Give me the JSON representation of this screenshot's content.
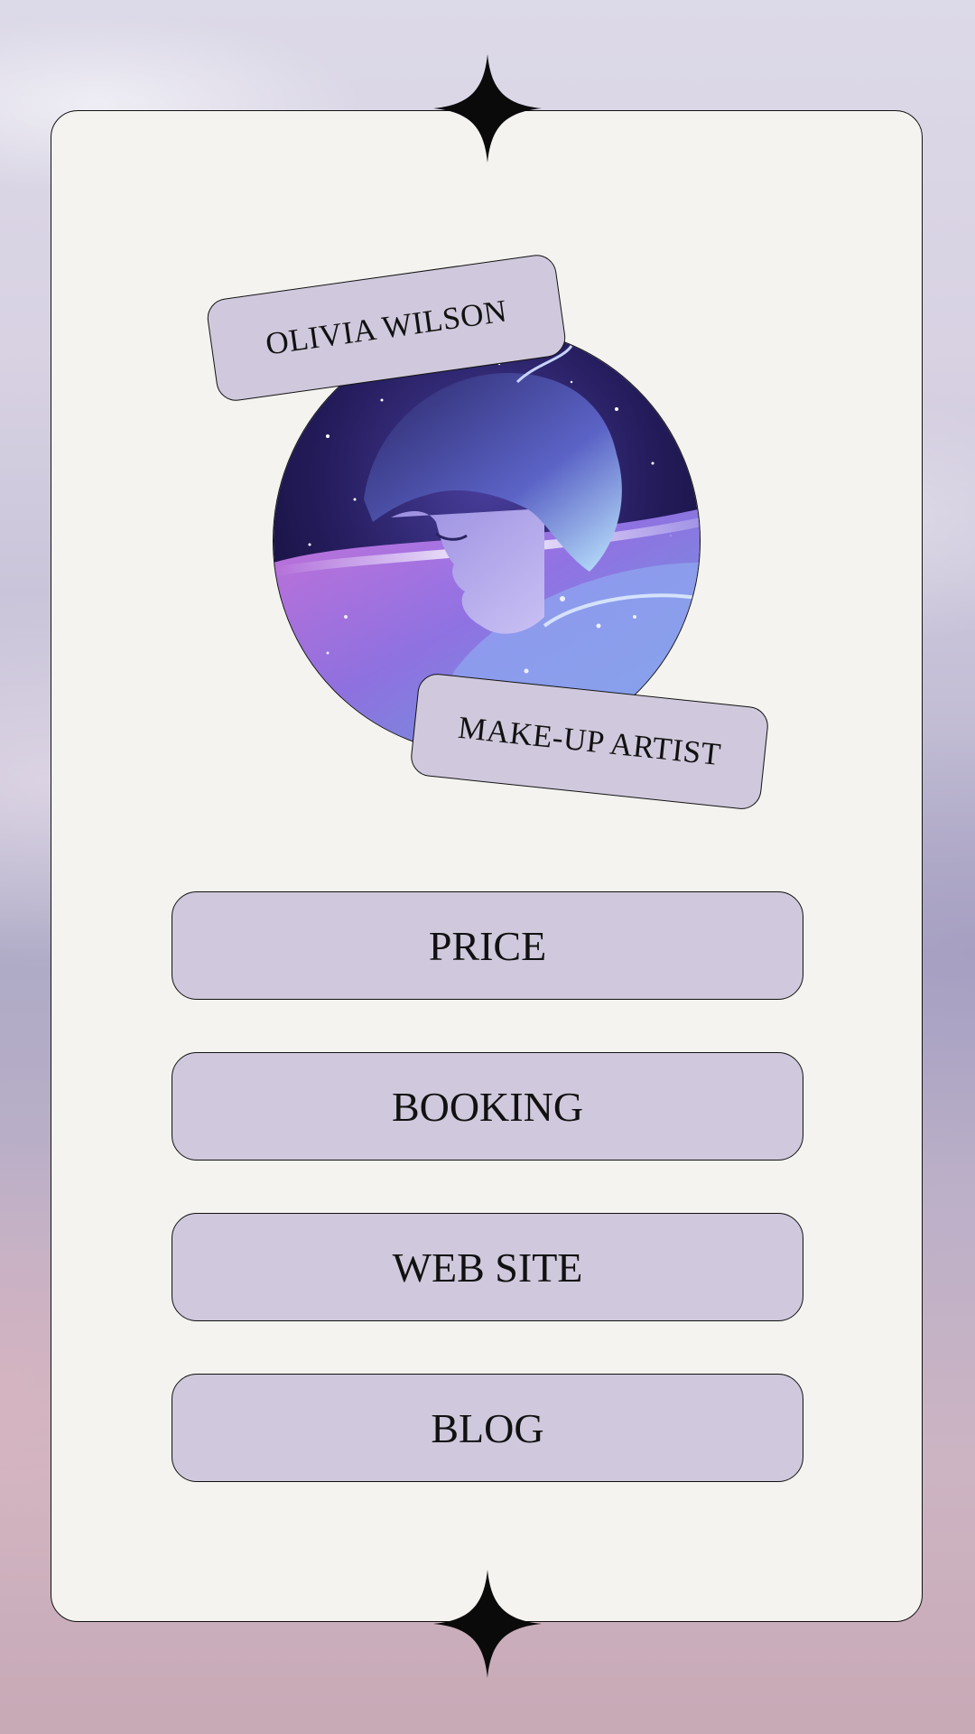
{
  "profile": {
    "name": "OLIVIA WILSON",
    "role": "MAKE-UP ARTIST"
  },
  "links": [
    {
      "label": "PRICE"
    },
    {
      "label": "BOOKING"
    },
    {
      "label": "WEB SITE"
    },
    {
      "label": "BLOG"
    }
  ],
  "icons": {
    "top": "sparkle-star-icon",
    "bottom": "sparkle-star-icon"
  },
  "colors": {
    "card_background": "#f4f3f0",
    "button_fill": "#d0c8dc",
    "outline": "#111111",
    "star": "#0a0a0a"
  }
}
